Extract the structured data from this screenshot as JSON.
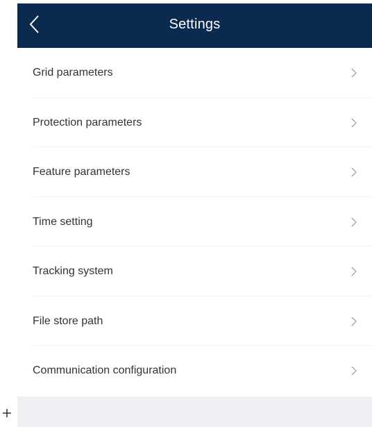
{
  "header": {
    "title": "Settings",
    "back_icon": "chevron-left-icon"
  },
  "menu": {
    "items": [
      {
        "label": "Grid parameters",
        "icon": "chevron-right-icon"
      },
      {
        "label": "Protection parameters",
        "icon": "chevron-right-icon"
      },
      {
        "label": "Feature parameters",
        "icon": "chevron-right-icon"
      },
      {
        "label": "Time setting",
        "icon": "chevron-right-icon"
      },
      {
        "label": "Tracking system",
        "icon": "chevron-right-icon"
      },
      {
        "label": "File store path",
        "icon": "chevron-right-icon"
      },
      {
        "label": "Communication configuration",
        "icon": "chevron-right-icon"
      }
    ]
  },
  "colors": {
    "header_background": "#0b2a4f",
    "header_text": "#ffffff",
    "item_text": "#333333",
    "chevron": "#8a8a8a",
    "divider": "#f0f0f0",
    "footer_background": "#eeeff2"
  },
  "decor": {
    "plus_icon": "plus-icon"
  }
}
